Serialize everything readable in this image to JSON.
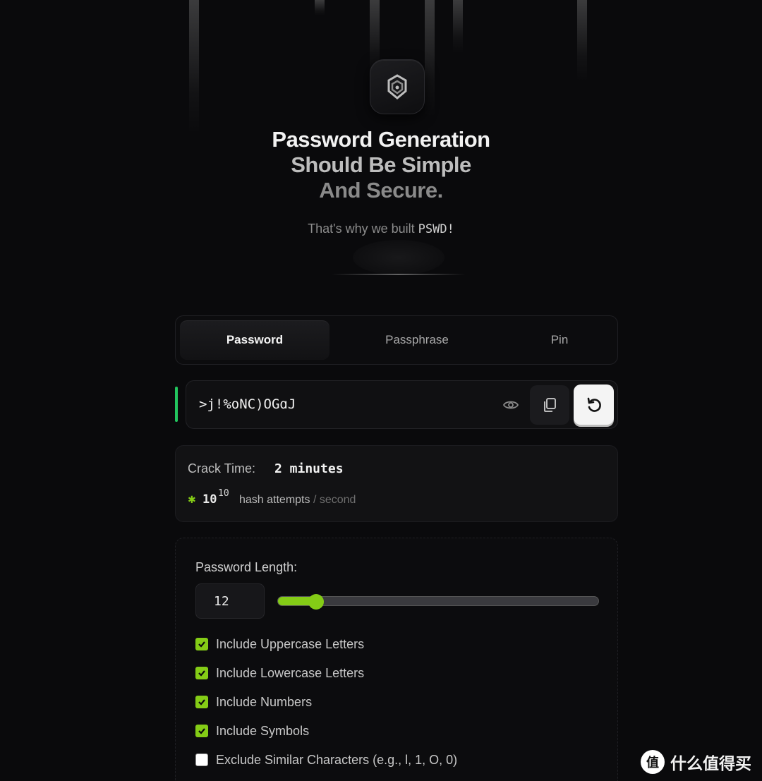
{
  "hero": {
    "logo_icon": "lock-shield-icon",
    "headline_line1": "Password Generation",
    "headline_line2": "Should Be Simple",
    "headline_line3": "And Secure.",
    "tagline_text": "That's why we built ",
    "tagline_brand": "PSWD!"
  },
  "tabs": [
    {
      "label": "Password",
      "active": true
    },
    {
      "label": "Passphrase",
      "active": false
    },
    {
      "label": "Pin",
      "active": false
    }
  ],
  "password": {
    "value": ">j!%oNC)OGɑJ",
    "strength_color": "#22c55e",
    "eye_icon": "eye-icon",
    "copy_icon": "copy-icon",
    "regenerate_icon": "refresh-icon"
  },
  "crack": {
    "label": "Crack Time:",
    "value": "2 minutes",
    "rate_prefix": "✱",
    "rate_base": "10",
    "rate_exponent": "10",
    "rate_unit": "hash attempts",
    "rate_sep": " / second"
  },
  "settings": {
    "length_label": "Password Length:",
    "length_value": "12",
    "slider_fraction": 0.12,
    "accent_color": "#84cc16",
    "options": [
      {
        "label": "Include Uppercase Letters",
        "checked": true
      },
      {
        "label": "Include Lowercase Letters",
        "checked": true
      },
      {
        "label": "Include Numbers",
        "checked": true
      },
      {
        "label": "Include Symbols",
        "checked": true
      },
      {
        "label": "Exclude Similar Characters (e.g., l, 1, O, 0)",
        "checked": false
      }
    ]
  },
  "watermark": {
    "glyph": "值",
    "text": "什么值得买"
  }
}
